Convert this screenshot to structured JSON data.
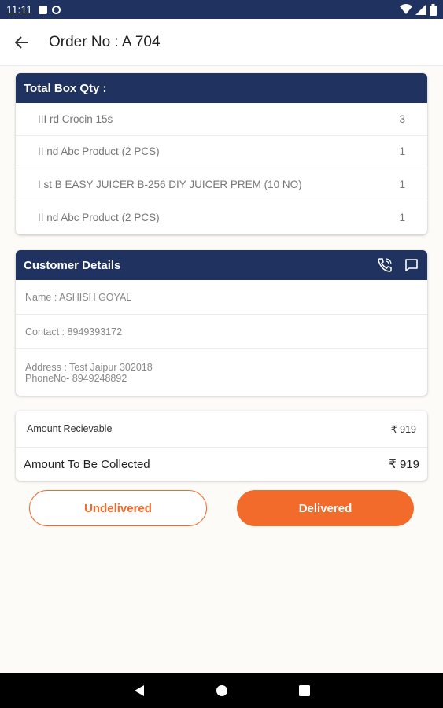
{
  "status_bar": {
    "time": "11:11"
  },
  "app_bar": {
    "title": "Order No : A 704"
  },
  "box_card": {
    "title": "Total Box Qty :",
    "items": [
      {
        "name": "III rd Crocin 15s",
        "qty": "3"
      },
      {
        "name": "II nd  Abc Product (2 PCS)",
        "qty": "1"
      },
      {
        "name": "I st B EASY JUICER B-256 DIY JUICER PREM (10 NO)",
        "qty": "1"
      },
      {
        "name": "II nd  Abc Product (2 PCS)",
        "qty": "1"
      }
    ]
  },
  "customer": {
    "title": "Customer Details",
    "name": "Name : ASHISH GOYAL",
    "contact": "Contact : 8949393172",
    "address": "Address : Test Jaipur 302018",
    "phone": "PhoneNo- 8949248892"
  },
  "amounts": {
    "receivable_label": "Amount Recievable",
    "receivable_value": "₹ 919",
    "collect_label": "Amount To Be Collected",
    "collect_value": "₹ 919"
  },
  "actions": {
    "undelivered": "Undelivered",
    "delivered": "Delivered"
  },
  "colors": {
    "primary": "#1f3260",
    "accent": "#f26b2b",
    "background": "#fdfbf7"
  }
}
